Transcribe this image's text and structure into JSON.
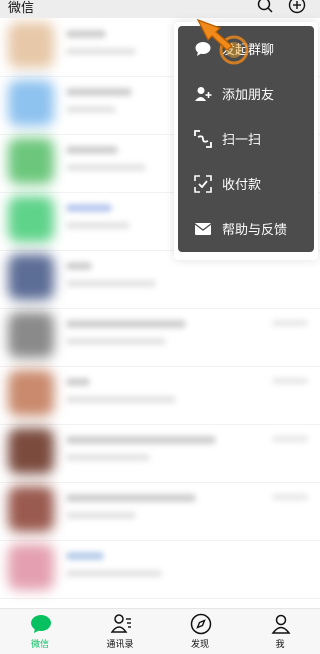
{
  "header": {
    "title": "微信",
    "search_icon": "search-icon",
    "add_icon": "plus-circle-icon"
  },
  "menu": {
    "items": [
      {
        "label": "发起群聊",
        "icon": "chat-bubble-icon"
      },
      {
        "label": "添加朋友",
        "icon": "add-friend-icon"
      },
      {
        "label": "扫一扫",
        "icon": "scan-icon"
      },
      {
        "label": "收付款",
        "icon": "payment-icon"
      },
      {
        "label": "帮助与反馈",
        "icon": "mail-icon"
      }
    ]
  },
  "bottom_nav": {
    "tabs": [
      {
        "label": "微信",
        "icon": "chat-icon",
        "active": true
      },
      {
        "label": "通讯录",
        "icon": "contacts-icon",
        "active": false
      },
      {
        "label": "发现",
        "icon": "compass-icon",
        "active": false
      },
      {
        "label": "我",
        "icon": "person-icon",
        "active": false
      }
    ]
  },
  "colors": {
    "accent": "#07c160",
    "menu_bg": "#4c4c4c",
    "header_bg": "#ededed",
    "pointer_arrow": "#f08a1a"
  }
}
